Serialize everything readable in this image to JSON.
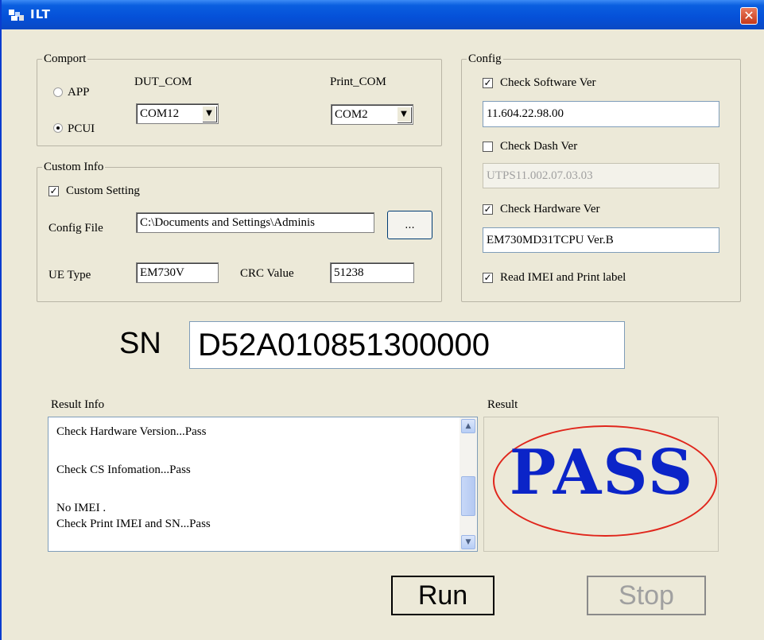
{
  "window": {
    "title": "ILT",
    "close_glyph": "✕",
    "icon": "app-icon"
  },
  "comport": {
    "legend": "Comport",
    "radio_app": "APP",
    "radio_pcui": "PCUI",
    "selected_radio": "PCUI",
    "dut_label": "DUT_COM",
    "dut_value": "COM12",
    "print_label": "Print_COM",
    "print_value": "COM2"
  },
  "custom": {
    "legend": "Custom Info",
    "setting_label": "Custom Setting",
    "setting_checked": true,
    "config_file_label": "Config File",
    "config_file_value": "C:\\Documents and Settings\\Adminis",
    "browse_label": "...",
    "ue_type_label": "UE Type",
    "ue_type_value": "EM730V",
    "crc_label": "CRC Value",
    "crc_value": "51238"
  },
  "config": {
    "legend": "Config",
    "sw_label": "Check Software Ver",
    "sw_checked": true,
    "sw_value": "11.604.22.98.00",
    "dash_label": "Check Dash Ver",
    "dash_checked": false,
    "dash_value": "UTPS11.002.07.03.03",
    "hw_label": "Check  Hardware Ver",
    "hw_checked": true,
    "hw_value": "EM730MD31TCPU Ver.B",
    "imei_label": "Read  IMEI and Print label",
    "imei_checked": true,
    "check_glyph": "✓"
  },
  "sn": {
    "label": "SN",
    "value": "D52A010851300000"
  },
  "result_info": {
    "label": "Result Info",
    "lines": [
      "Check Hardware Version...Pass",
      "",
      "Check CS Infomation...Pass",
      "",
      "No IMEI .",
      "Check Print IMEI and SN...Pass"
    ],
    "scroll_up_glyph": "▲",
    "scroll_down_glyph": "▼"
  },
  "result": {
    "label": "Result",
    "status": "PASS",
    "status_color": "#0b24c8",
    "ring_color": "#e0261c"
  },
  "actions": {
    "run_label": "Run",
    "stop_label": "Stop",
    "stop_enabled": false
  },
  "colors": {
    "titlebar": "#0550d8",
    "window_bg": "#ece9d8",
    "disabled_text": "#a0a0a0"
  }
}
